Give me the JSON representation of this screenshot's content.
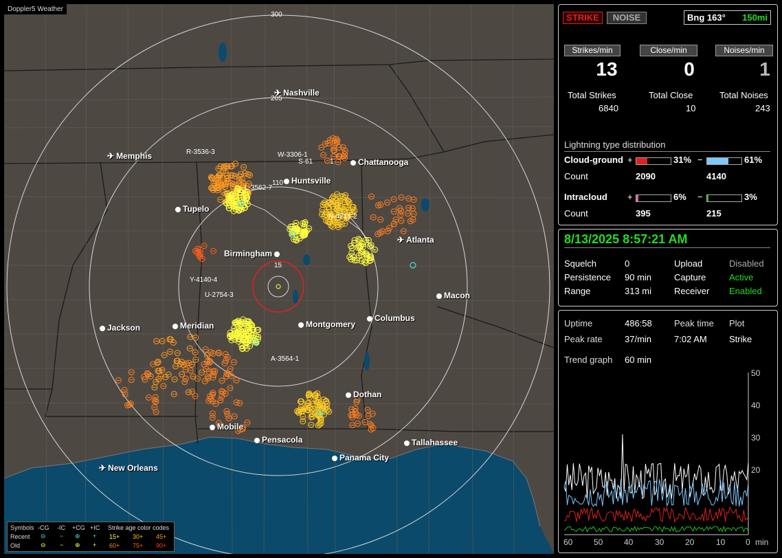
{
  "app": {
    "title": "Doppler5 Weather"
  },
  "map": {
    "rings": [
      "300",
      "205",
      "110",
      "15"
    ],
    "cities": [
      {
        "name": "Nashville",
        "icon": "airport"
      },
      {
        "name": "Memphis",
        "icon": "airport"
      },
      {
        "name": "Chattanooga",
        "icon": "dot"
      },
      {
        "name": "Huntsville",
        "icon": "dot"
      },
      {
        "name": "Tupelo",
        "icon": "dot"
      },
      {
        "name": "Atlanta",
        "icon": "airport"
      },
      {
        "name": "Birmingham",
        "icon": "dot"
      },
      {
        "name": "Macon",
        "icon": "dot"
      },
      {
        "name": "Jackson",
        "icon": "dot"
      },
      {
        "name": "Meridian",
        "icon": "dot"
      },
      {
        "name": "Montgomery",
        "icon": "dot"
      },
      {
        "name": "Columbus",
        "icon": "dot"
      },
      {
        "name": "Dothan",
        "icon": "dot"
      },
      {
        "name": "Mobile",
        "icon": "dot"
      },
      {
        "name": "Pensacola",
        "icon": "dot"
      },
      {
        "name": "Tallahassee",
        "icon": "dot"
      },
      {
        "name": "Panama City",
        "icon": "dot"
      },
      {
        "name": "New Orleans",
        "icon": "airport"
      }
    ],
    "storms": [
      "R-3536-3",
      "W-3306-1",
      "S-61",
      "1",
      "L-3562-7",
      "N-4715-2",
      "Y-4140-4",
      "U-2754-3",
      "A-3564-1"
    ],
    "legend": {
      "symbols_label": "Symbols",
      "cg_minus": "-CG",
      "ic_minus": "-IC",
      "cg_plus": "+CG",
      "ic_plus": "+IC",
      "age_label": "Strike age color codes",
      "recent": "Recent",
      "old": "Old",
      "recent_codes": [
        "15+",
        "30+",
        "45+"
      ],
      "old_codes": [
        "60+",
        "75+",
        "90+"
      ],
      "sym_recent": [
        "⊖",
        "−",
        "⊕",
        "+"
      ],
      "sym_old": [
        "⊖",
        "−",
        "⊕",
        "+"
      ]
    }
  },
  "status": {
    "strike_btn": "STRIKE",
    "noise_btn": "NOISE",
    "bearing": "Bng 163°",
    "range": "150mi",
    "strikes_min_label": "Strikes/min",
    "close_min_label": "Close/min",
    "noises_min_label": "Noises/min",
    "strikes_min": "13",
    "close_min": "0",
    "noises_min": "1",
    "total_strikes_label": "Total Strikes",
    "total_close_label": "Total Close",
    "total_noises_label": "Total Noises",
    "total_strikes": "6840",
    "total_close": "10",
    "total_noises": "243",
    "dist_title": "Lightning type distribution",
    "cg_label": "Cloud-ground",
    "ic_label": "Intracloud",
    "count_label": "Count",
    "plus": "+",
    "minus": "−",
    "cg_pos_pct": "31%",
    "cg_neg_pct": "61%",
    "cg_pos_count": "2090",
    "cg_neg_count": "4140",
    "ic_pos_pct": "6%",
    "ic_neg_pct": "3%",
    "ic_pos_count": "395",
    "ic_neg_count": "215",
    "cg_pos_frac": 0.31,
    "cg_neg_frac": 0.61,
    "ic_pos_frac": 0.06,
    "ic_neg_frac": 0.03
  },
  "settings": {
    "datetime": "8/13/2025 8:57:21 AM",
    "squelch_label": "Squelch",
    "squelch": "0",
    "persistence_label": "Persistence",
    "persistence": "90 min",
    "range_label": "Range",
    "range": "313 mi",
    "upload_label": "Upload",
    "upload": "Disabled",
    "capture_label": "Capture",
    "capture": "Active",
    "receiver_label": "Receiver",
    "receiver": "Enabled"
  },
  "trend": {
    "uptime_label": "Uptime",
    "uptime": "486:58",
    "peak_time_label": "Peak time",
    "peak_time": "7:02 AM",
    "plot_label": "Plot",
    "plot": "Strike",
    "peak_rate_label": "Peak rate",
    "peak_rate": "37/min",
    "trend_graph_label": "Trend graph",
    "trend_graph": "60 min",
    "y_ticks": [
      "50",
      "40",
      "30",
      "20"
    ],
    "x_ticks": [
      "60",
      "50",
      "40",
      "30",
      "20",
      "10",
      "0"
    ],
    "x_unit": "min"
  },
  "colors": {
    "accent_green": "#22dd22",
    "strike_red": "#e02020",
    "plus_cg": "#e02020",
    "minus_cg": "#7ec8ff",
    "plus_ic": "#e060a0",
    "minus_ic": "#20c020"
  }
}
